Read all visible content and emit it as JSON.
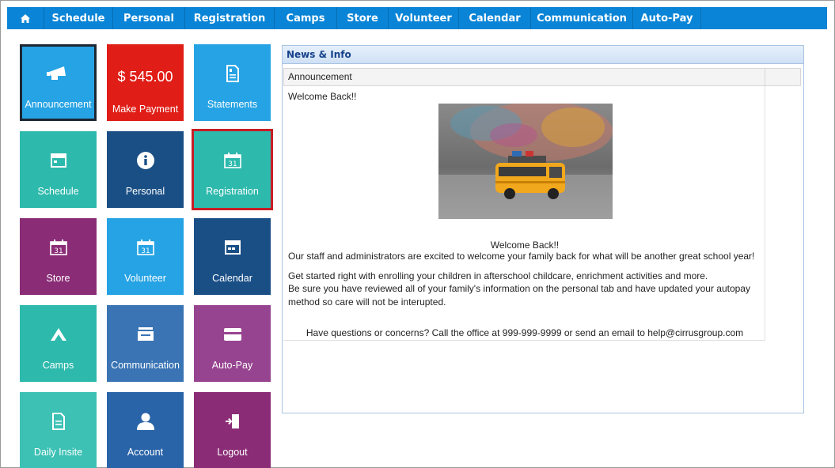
{
  "nav": {
    "items": [
      "Schedule",
      "Personal",
      "Registration",
      "Camps",
      "Store",
      "Volunteer",
      "Calendar",
      "Communication",
      "Auto-Pay"
    ]
  },
  "tiles": {
    "announcement": "Announcement",
    "payment_amount": "$ 545.00",
    "make_payment": "Make Payment",
    "statements": "Statements",
    "schedule": "Schedule",
    "personal": "Personal",
    "registration": "Registration",
    "store": "Store",
    "volunteer": "Volunteer",
    "calendar": "Calendar",
    "camps": "Camps",
    "communication": "Communication",
    "autopay": "Auto-Pay",
    "daily_insite": "Daily Insite",
    "account": "Account",
    "logout": "Logout",
    "calendar_day": "31"
  },
  "news": {
    "title": "News & Info",
    "column": "Announcement",
    "welcome_top": "Welcome Back!!",
    "welcome_mid": "Welcome Back!!",
    "line1": "Our staff and administrators are excited to welcome your family back for what will be another great school year!",
    "line2": "Get started right with enrolling your children in afterschool childcare, enrichment activities and more.",
    "line3": "Be sure you have reviewed all of your family's  information on the personal tab and have updated your autopay",
    "line4": "method so care will not be interupted.",
    "contact": "Have questions or concerns?  Call the office at 999-999-9999 or send an email to help@cirrusgroup.com"
  },
  "colors": {
    "nav": "#0a84d6",
    "blue_tile": "#26a3e4",
    "navy_tile": "#1a4f86",
    "teal_tile": "#2db9ac",
    "purple_tile": "#8a2c76",
    "red_tile": "#e01d16"
  }
}
